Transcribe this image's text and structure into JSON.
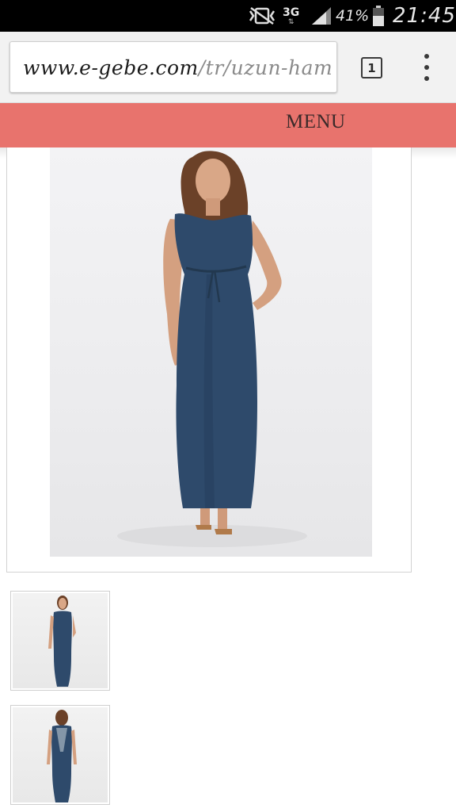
{
  "status_bar": {
    "network": "3G",
    "battery": "41%",
    "time": "21:45",
    "icons": [
      "vibrate-icon",
      "signal-icon",
      "battery-icon"
    ]
  },
  "browser": {
    "url_host": "www.e-gebe.com",
    "url_path": "/tr/uzun-ham",
    "tab_count": "1"
  },
  "site": {
    "menu_label": "MENU",
    "menu_color": "#e8736d"
  },
  "product": {
    "dress_color": "#2e4a6b",
    "images": [
      "main-photo",
      "thumb-front",
      "thumb-back"
    ]
  }
}
